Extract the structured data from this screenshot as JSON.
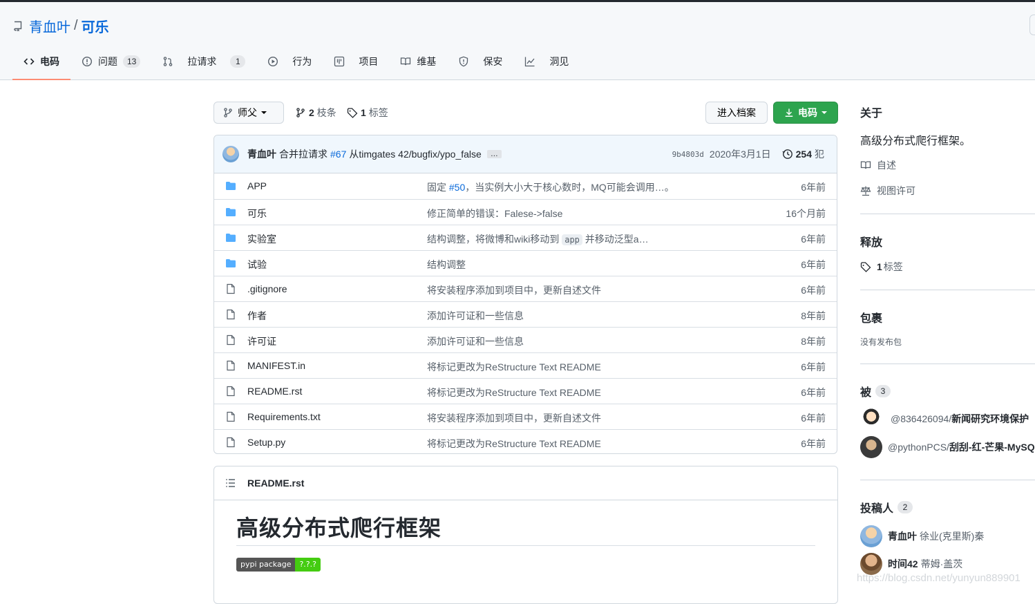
{
  "repo": {
    "owner": "青血叶",
    "separator": "/",
    "name": "可乐"
  },
  "tabs": [
    {
      "label": "电码",
      "icon": "code-icon",
      "counter": ""
    },
    {
      "label": "问题",
      "icon": "issue-icon",
      "counter": "13"
    },
    {
      "label": "拉请求",
      "icon": "pull-request-icon",
      "counter": "1"
    },
    {
      "label": "行为",
      "icon": "play-icon",
      "counter": ""
    },
    {
      "label": "项目",
      "icon": "project-icon",
      "counter": ""
    },
    {
      "label": "维基",
      "icon": "book-icon",
      "counter": ""
    },
    {
      "label": "保安",
      "icon": "shield-icon",
      "counter": ""
    },
    {
      "label": "洞见",
      "icon": "graph-icon",
      "counter": ""
    }
  ],
  "toolbar": {
    "branch": "师父",
    "branches_count": "2",
    "branches_label": "枝条",
    "tags_count": "1",
    "tags_label": "标签",
    "archive_label": "进入档案",
    "code_label": "电码"
  },
  "commit": {
    "author": "青血叶",
    "message": "合并拉请求",
    "pr": "#67",
    "from": "从timgates 42/bugfix/ypo_false",
    "more": "…",
    "sha": "9b4803d",
    "date": "2020年3月1日",
    "count": "254",
    "count_label": "犯"
  },
  "files": [
    {
      "type": "dir",
      "name": "APP",
      "msg_pre": "固定 ",
      "msg_link": "#50",
      "msg_post": "，当实例大小大于核心数时，MQ可能会调用…。",
      "age": "6年前"
    },
    {
      "type": "dir",
      "name": "可乐",
      "msg_pre": "修正简单的错误：Falese->false",
      "msg_link": "",
      "msg_post": "",
      "age": "16个月前"
    },
    {
      "type": "dir",
      "name": "实验室",
      "msg_pre": "结构调整，将微博和wiki移动到 ",
      "msg_code": "app",
      "msg_post": " 并移动泛型a…",
      "age": "6年前"
    },
    {
      "type": "dir",
      "name": "试验",
      "msg_pre": "结构调整",
      "msg_link": "",
      "msg_post": "",
      "age": "6年前"
    },
    {
      "type": "file",
      "name": ".gitignore",
      "msg_pre": "将安装程序添加到项目中，更新自述文件",
      "msg_link": "",
      "msg_post": "",
      "age": "6年前"
    },
    {
      "type": "file",
      "name": "作者",
      "msg_pre": "添加许可证和一些信息",
      "msg_link": "",
      "msg_post": "",
      "age": "8年前"
    },
    {
      "type": "file",
      "name": "许可证",
      "msg_pre": "添加许可证和一些信息",
      "msg_link": "",
      "msg_post": "",
      "age": "8年前"
    },
    {
      "type": "file",
      "name": "MANIFEST.in",
      "msg_pre": "将标记更改为ReStructure Text README",
      "msg_link": "",
      "msg_post": "",
      "age": "6年前"
    },
    {
      "type": "file",
      "name": "README.rst",
      "msg_pre": "将标记更改为ReStructure Text README",
      "msg_link": "",
      "msg_post": "",
      "age": "6年前"
    },
    {
      "type": "file",
      "name": "Requirements.txt",
      "msg_pre": "将安装程序添加到项目中，更新自述文件",
      "msg_link": "",
      "msg_post": "",
      "age": "6年前"
    },
    {
      "type": "file",
      "name": "Setup.py",
      "msg_pre": "将标记更改为ReStructure Text README",
      "msg_link": "",
      "msg_post": "",
      "age": "6年前"
    }
  ],
  "readme": {
    "filename": "README.rst",
    "heading": "高级分布式爬行框架",
    "badge_left": "pypi package",
    "badge_right": "?.?.?"
  },
  "sidebar": {
    "about_title": "关于",
    "about_text": "高级分布式爬行框架。",
    "readme_link": "自述",
    "license_link": "视图许可",
    "releases_title": "释放",
    "releases_tag_count": "1",
    "releases_tag_label": "标签",
    "packages_title": "包裹",
    "packages_text": "没有发布包",
    "forks_title": "被",
    "forks_count": "3",
    "forks": [
      {
        "user": "@836426094",
        "sep": " / ",
        "repo": "新闻研究环境保护"
      },
      {
        "user": "@pythonPCS",
        "sep": "/",
        "repo": "刮刮-红-芒果-MySQ"
      }
    ],
    "contributors_title": "投稿人",
    "contributors_count": "2",
    "contributors": [
      {
        "login": "青血叶",
        "name": "徐业(克里斯)秦"
      },
      {
        "login": "时间42",
        "name": "蒂姆·盖茨"
      }
    ]
  },
  "watermark": "https://blog.csdn.net/yunyun889901",
  "colors": {
    "accent": "#0969da",
    "code_button": "#2da44e",
    "tab_underline": "#fd8c73",
    "folder": "#54aeff"
  }
}
